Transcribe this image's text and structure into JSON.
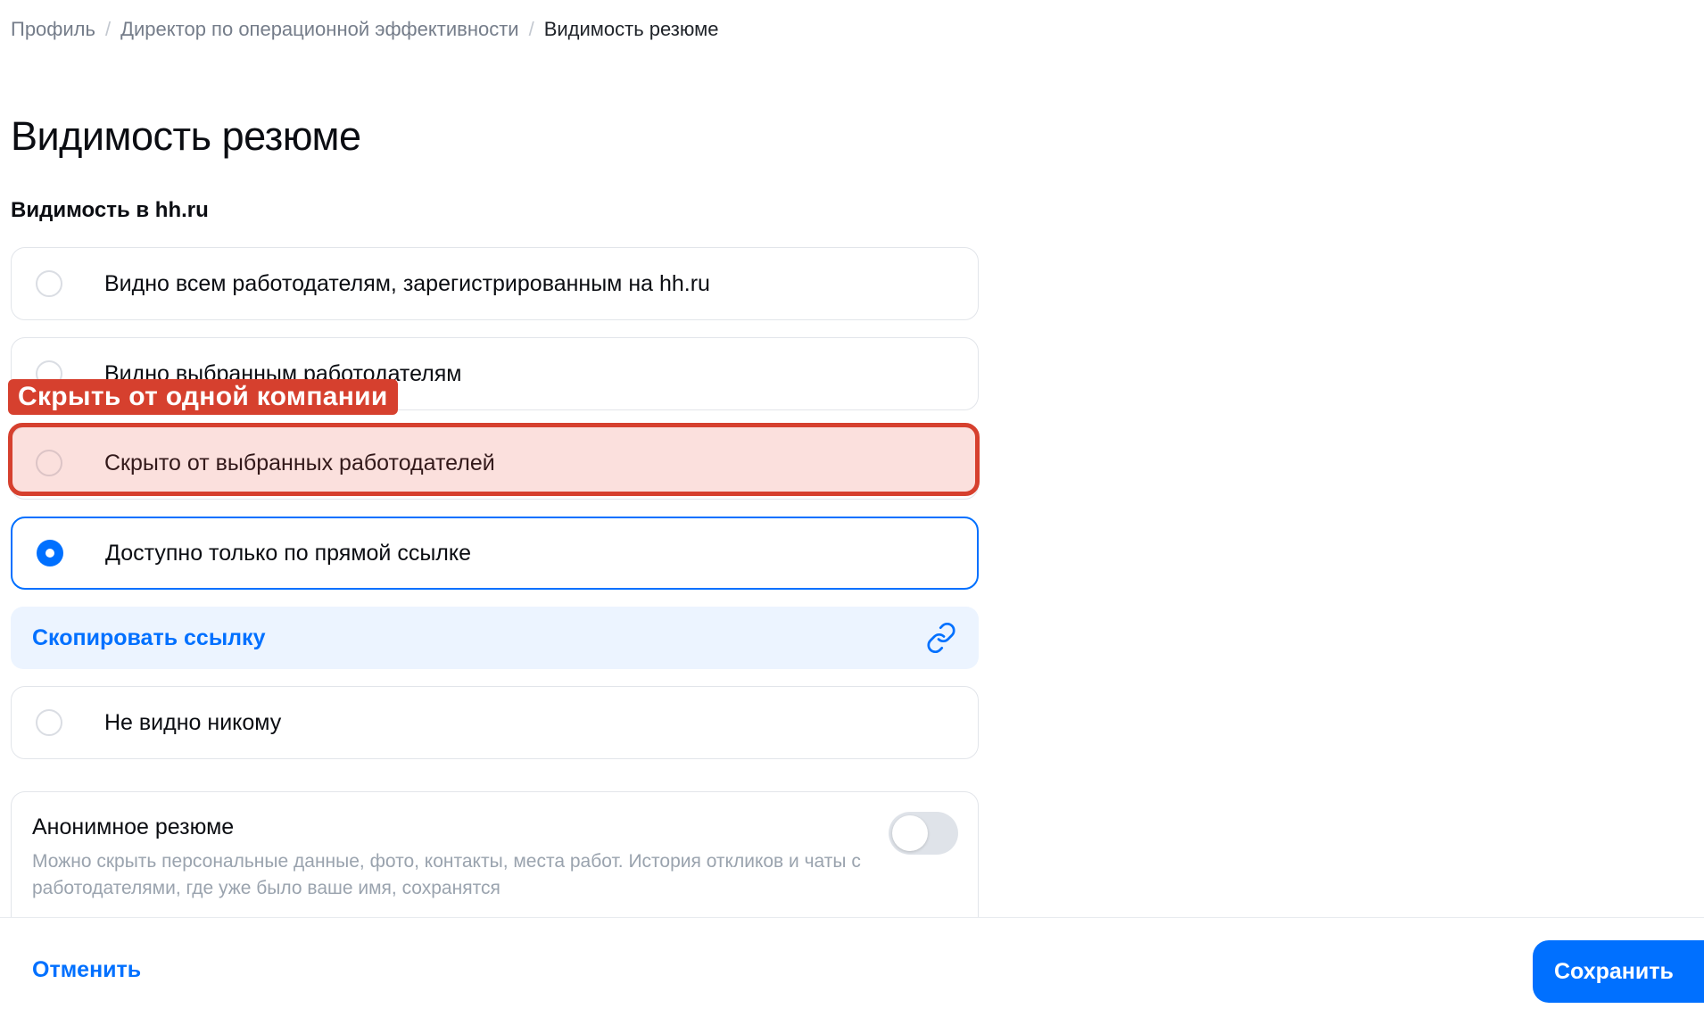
{
  "breadcrumb": {
    "items": [
      "Профиль",
      "Директор по операционной эффективности"
    ],
    "separator": "/",
    "current": "Видимость резюме"
  },
  "page": {
    "title": "Видимость резюме",
    "section_title": "Видимость в hh.ru"
  },
  "options": [
    {
      "label": "Видно всем работодателям, зарегистрированным на hh.ru",
      "selected": false
    },
    {
      "label": "Видно выбранным работодателям",
      "selected": false
    },
    {
      "label": "Скрыто от выбранных работодателей",
      "selected": false
    },
    {
      "label": "Доступно только по прямой ссылке",
      "selected": true
    },
    {
      "label": "Не видно никому",
      "selected": false
    }
  ],
  "copy_link": {
    "label": "Скопировать ссылку",
    "icon": "link-icon"
  },
  "highlight": {
    "tag": "Скрыть от одной компании",
    "color": "#d6402e"
  },
  "anonymous": {
    "title": "Анонимное резюме",
    "description": "Можно скрыть персональные данные, фото, контакты, места работ. История откликов и чаты с работодателями, где уже было ваше имя, сохранятся",
    "enabled": false
  },
  "footer": {
    "cancel_label": "Отменить",
    "save_label": "Сохранить"
  },
  "colors": {
    "accent": "#0070ff",
    "copy_bg": "#ecf4ff",
    "highlight": "#d6402e"
  }
}
